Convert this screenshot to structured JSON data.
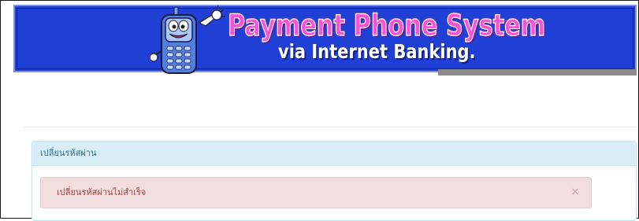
{
  "banner": {
    "title": "Payment Phone System",
    "subtitle": "via Internet Banking.",
    "mascot_icon": "phone-mascot-icon",
    "colors": {
      "background": "#1f3fd6",
      "title": "#ff4fd8",
      "subtitle": "#ffffff"
    }
  },
  "panel": {
    "heading": "เปลี่ยนรหัสผ่าน",
    "alert": {
      "message": "เปลี่ยนรหัสผ่านไม่สำเร็จ",
      "close_label": "×",
      "close_icon": "close-icon"
    }
  }
}
